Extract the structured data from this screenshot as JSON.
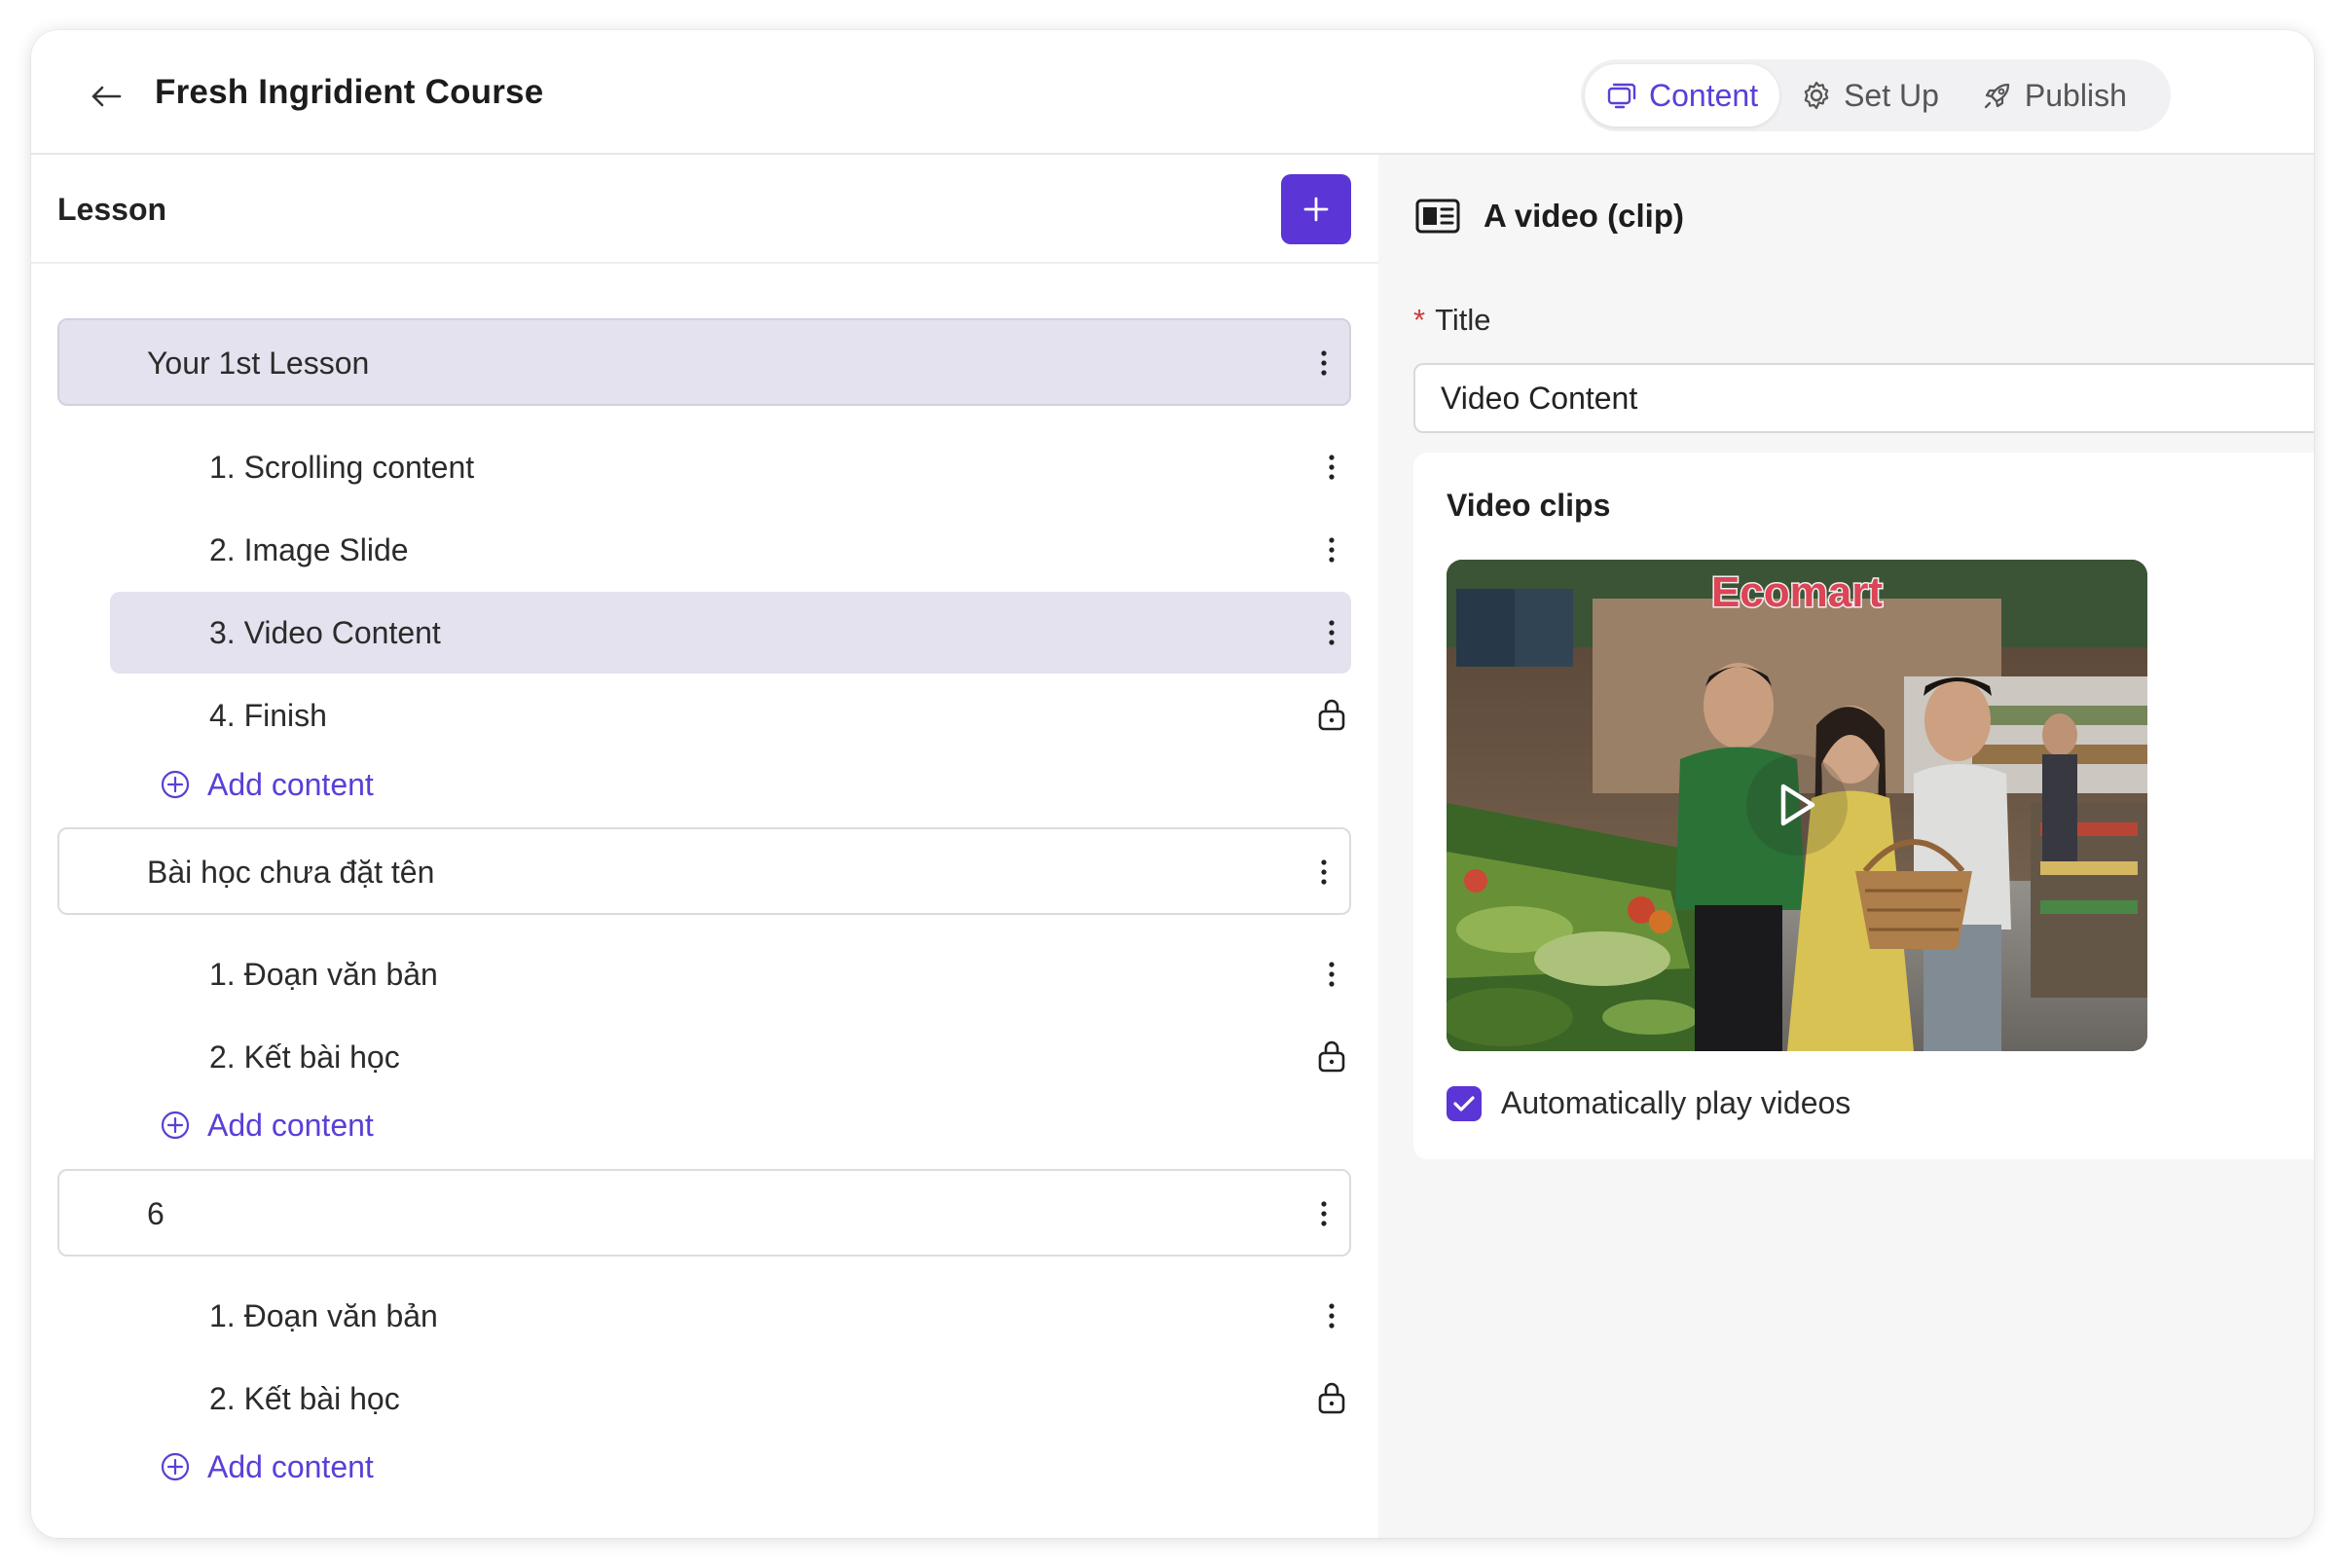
{
  "header": {
    "title": "Fresh Ingridient Course",
    "tabs": [
      {
        "label": "Content",
        "icon": "content-icon",
        "active": true
      },
      {
        "label": "Set Up",
        "icon": "gear-icon",
        "active": false
      },
      {
        "label": "Publish",
        "icon": "rocket-icon",
        "active": false
      }
    ]
  },
  "sidebar": {
    "heading": "Lesson",
    "add_content_label": "Add content",
    "lessons": [
      {
        "name": "Your 1st Lesson",
        "selected": true,
        "items": [
          {
            "label": "1. Scrolling content",
            "locked": false,
            "selected": false
          },
          {
            "label": "2. Image Slide",
            "locked": false,
            "selected": false
          },
          {
            "label": "3. Video Content",
            "locked": false,
            "selected": true
          },
          {
            "label": "4. Finish",
            "locked": true,
            "selected": false
          }
        ]
      },
      {
        "name": "Bài học chưa đặt tên",
        "selected": false,
        "items": [
          {
            "label": "1. Đoạn văn bản",
            "locked": false,
            "selected": false
          },
          {
            "label": "2. Kết bài học",
            "locked": true,
            "selected": false
          }
        ]
      },
      {
        "name": "6",
        "selected": false,
        "items": [
          {
            "label": "1. Đoạn văn bản",
            "locked": false,
            "selected": false
          },
          {
            "label": "2. Kết bài học",
            "locked": true,
            "selected": false
          }
        ]
      }
    ]
  },
  "editor": {
    "type_label": "A video (clip)",
    "title_label": "Title",
    "title_value": "Video Content",
    "clips_heading": "Video clips",
    "video_sign_text": "Ecomart",
    "autoplay_label": "Automatically play videos",
    "autoplay_checked": true
  },
  "colors": {
    "accent": "#5b35d5",
    "selected_bg": "#e4e2ee",
    "panel_bg": "#f6f6f7"
  }
}
